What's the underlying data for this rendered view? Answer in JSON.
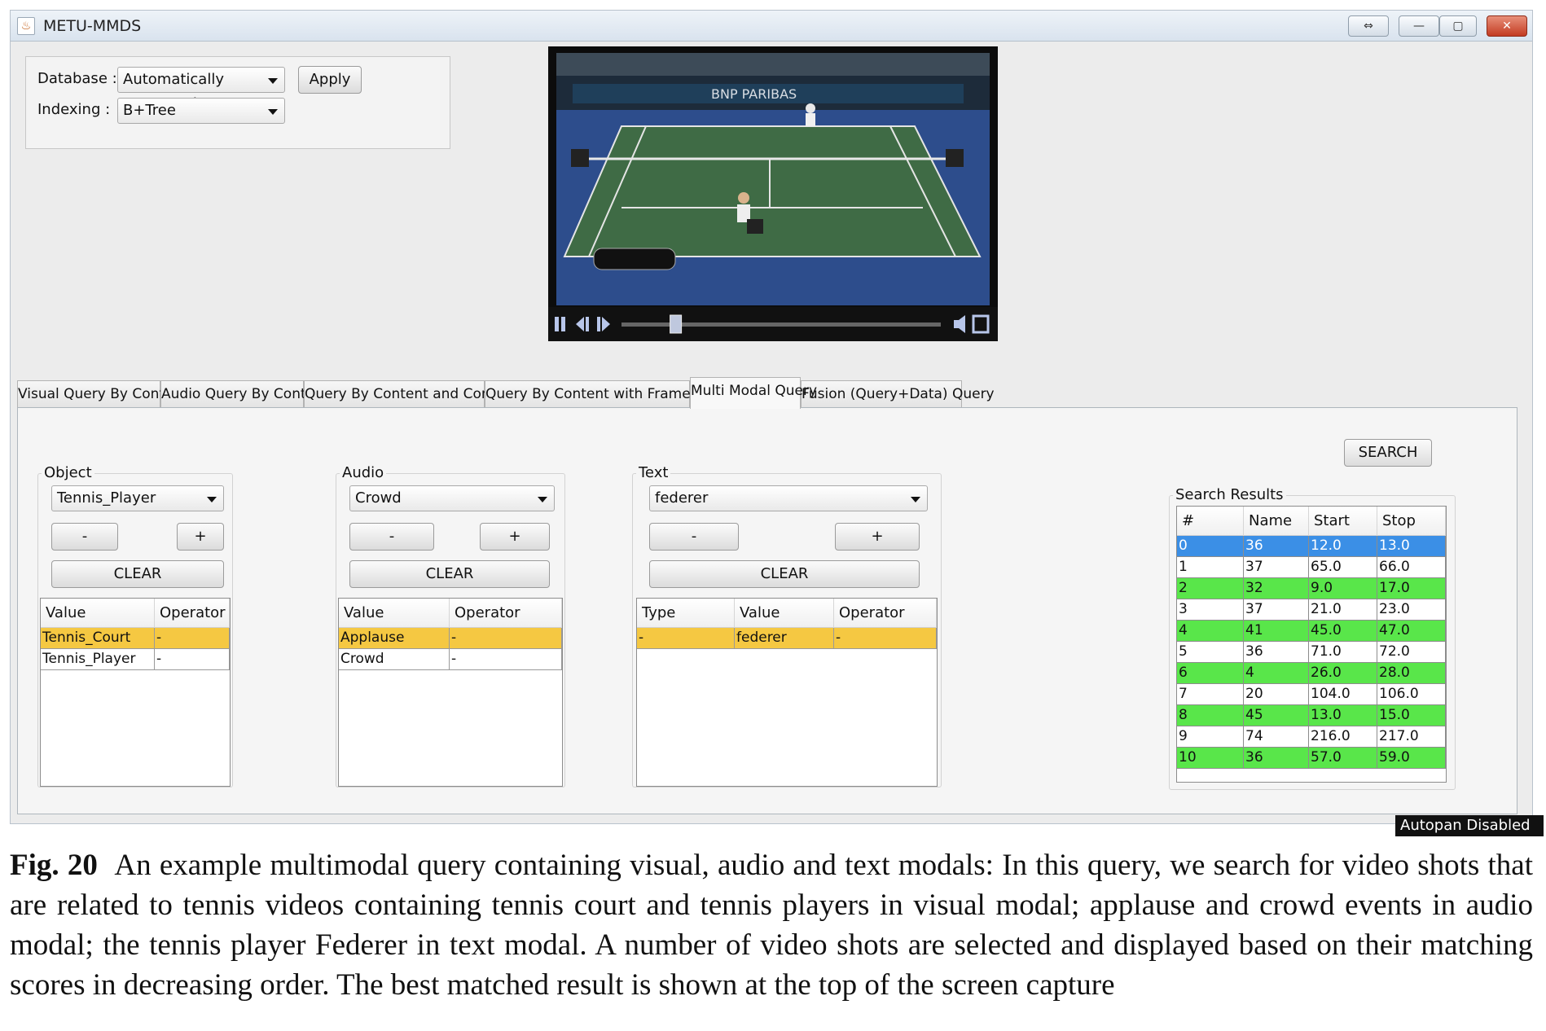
{
  "window": {
    "title": "METU-MMDS",
    "icon": "java-cup-icon",
    "controls": {
      "restore": "⇔",
      "minimize": "—",
      "maximize": "▢",
      "close": "✕"
    }
  },
  "settings": {
    "database_label": "Database :",
    "database_value": "Automatically Processed",
    "apply_label": "Apply",
    "indexing_label": "Indexing :",
    "indexing_value": "B+Tree"
  },
  "video": {
    "banner_text": "BNP PARIBAS",
    "progress": 0.17,
    "icons": [
      "pause-icon",
      "step-back-icon",
      "step-forward-icon",
      "volume-icon",
      "fullscreen-icon"
    ]
  },
  "tabs": [
    {
      "label": "Visual Query By Content",
      "active": false
    },
    {
      "label": "Audio Query By Content",
      "active": false
    },
    {
      "label": "Query By Content and Concept",
      "active": false
    },
    {
      "label": "Query By Content with Frame Image",
      "active": false
    },
    {
      "label": "Multi Modal Query",
      "active": true
    },
    {
      "label": "Fusion (Query+Data) Query",
      "active": false
    }
  ],
  "search_label": "SEARCH",
  "object_group": {
    "title": "Object",
    "selected": "Tennis_Player",
    "minus": "-",
    "plus": "+",
    "clear": "CLEAR",
    "columns": [
      "Value",
      "Operator"
    ],
    "rows": [
      {
        "value": "Tennis_Court",
        "operator": "-",
        "highlight": true
      },
      {
        "value": "Tennis_Player",
        "operator": "-",
        "highlight": false
      }
    ]
  },
  "audio_group": {
    "title": "Audio",
    "selected": "Crowd",
    "minus": "-",
    "plus": "+",
    "clear": "CLEAR",
    "columns": [
      "Value",
      "Operator"
    ],
    "rows": [
      {
        "value": "Applause",
        "operator": "-",
        "highlight": true
      },
      {
        "value": "Crowd",
        "operator": "-",
        "highlight": false
      }
    ]
  },
  "text_group": {
    "title": "Text",
    "selected": "federer",
    "minus": "-",
    "plus": "+",
    "clear": "CLEAR",
    "columns": [
      "Type",
      "Value",
      "Operator"
    ],
    "rows": [
      {
        "type": "-",
        "value": "federer",
        "operator": "-",
        "highlight": true
      }
    ]
  },
  "results": {
    "title": "Search Results",
    "columns": [
      "#",
      "Name",
      "Start",
      "Stop"
    ],
    "rows": [
      {
        "idx": "0",
        "name": "36",
        "start": "12.0",
        "stop": "13.0"
      },
      {
        "idx": "1",
        "name": "37",
        "start": "65.0",
        "stop": "66.0"
      },
      {
        "idx": "2",
        "name": "32",
        "start": "9.0",
        "stop": "17.0"
      },
      {
        "idx": "3",
        "name": "37",
        "start": "21.0",
        "stop": "23.0"
      },
      {
        "idx": "4",
        "name": "41",
        "start": "45.0",
        "stop": "47.0"
      },
      {
        "idx": "5",
        "name": "36",
        "start": "71.0",
        "stop": "72.0"
      },
      {
        "idx": "6",
        "name": "4",
        "start": "26.0",
        "stop": "28.0"
      },
      {
        "idx": "7",
        "name": "20",
        "start": "104.0",
        "stop": "106.0"
      },
      {
        "idx": "8",
        "name": "45",
        "start": "13.0",
        "stop": "15.0"
      },
      {
        "idx": "9",
        "name": "74",
        "start": "216.0",
        "stop": "217.0"
      },
      {
        "idx": "10",
        "name": "36",
        "start": "57.0",
        "stop": "59.0"
      }
    ],
    "colors": {
      "selected": "#3b8fe6",
      "highlight": "#59e64a"
    }
  },
  "status": "Autopan Disabled",
  "caption": {
    "label": "Fig. 20",
    "text": "An example multimodal query containing visual, audio and text modals: In this query, we search for video shots that are related to tennis videos containing tennis court and tennis players in visual modal; applause and crowd events in audio modal; the tennis player Federer in text modal. A number of video shots are selected and displayed based on their matching scores in decreasing order. The best matched result is shown at the top of the screen capture"
  }
}
